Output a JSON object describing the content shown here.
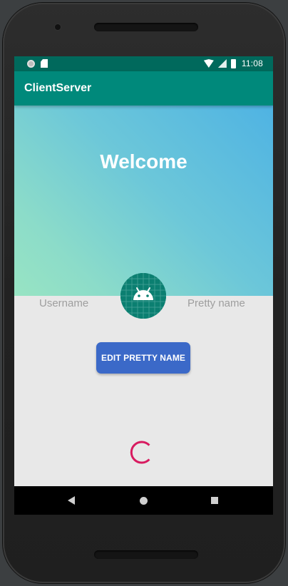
{
  "status_bar": {
    "time": "11:08",
    "icons": [
      "notification-circle-icon",
      "sd-card-icon",
      "wifi-icon",
      "signal-icon",
      "battery-icon"
    ]
  },
  "app_bar": {
    "title": "ClientServer"
  },
  "header": {
    "welcome": "Welcome",
    "gradient": [
      "#4fb3e3",
      "#98e4c3"
    ]
  },
  "profile": {
    "username_placeholder": "Username",
    "pretty_name_placeholder": "Pretty name",
    "avatar_icon": "android-icon"
  },
  "actions": {
    "edit_pretty_name_label": "EDIT PRETTY NAME"
  },
  "loading": {
    "spinner_icon": "loading-spinner-icon",
    "color": "#d81b60"
  },
  "navigation": {
    "back_icon": "back-icon",
    "home_icon": "home-icon",
    "recents_icon": "recents-icon"
  },
  "colors": {
    "status_bar": "#00695c",
    "app_bar": "#00897b",
    "button": "#3b69c8",
    "background": "#e8e8e8"
  }
}
